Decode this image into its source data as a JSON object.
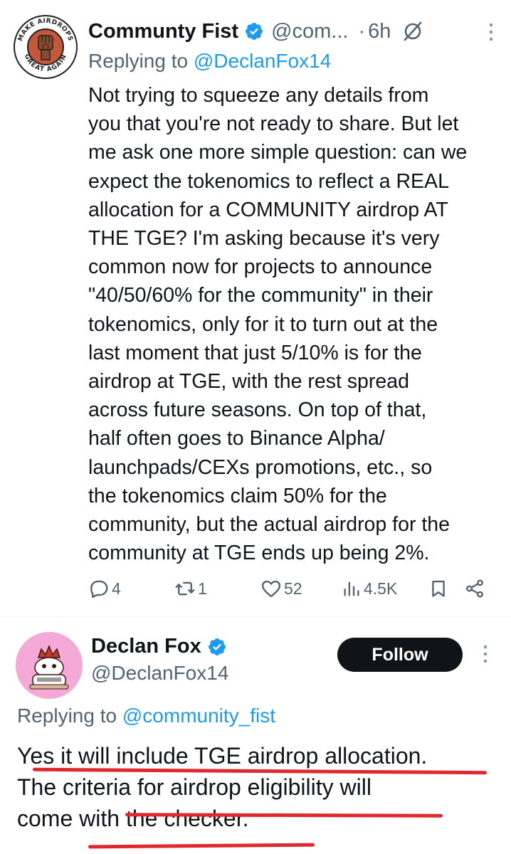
{
  "first_tweet": {
    "author_name": "Community Fist",
    "author_display": "Communty Fist",
    "handle": "@com...",
    "dot": "·",
    "time": "6h",
    "avatar_text_top": "MAKE AIRDROPS",
    "avatar_text_bottom": "GREAT AGAIN",
    "replying_prefix": "Replying to ",
    "replying_to": "@DeclanFox14",
    "text_lines": [
      "Not trying to squeeze any details from",
      "you that you're not ready to share. But let",
      "me ask one more simple question: can we",
      "expect the tokenomics to reflect a REAL",
      "allocation for a COMMUNITY airdrop AT",
      "THE TGE? I'm asking because it's very",
      "common now for projects to announce",
      "\"40/50/60% for the community\" in their",
      "tokenomics, only for it to turn out at the",
      "last moment that just 5/10% is for the",
      "airdrop at TGE, with the rest spread",
      "across future seasons. On top of that,",
      "half often goes to Binance Alpha/",
      "launchpads/CEXs promotions, etc., so",
      "the tokenomics claim 50% for the",
      "community, but the actual airdrop for the",
      "community at TGE ends up being 2%."
    ],
    "stats": {
      "replies": "4",
      "reposts": "1",
      "likes": "52",
      "views": "4.5K"
    }
  },
  "second_tweet": {
    "author_name": "Declan Fox",
    "handle": "@DeclanFox14",
    "follow_label": "Follow",
    "replying_prefix": "Replying to ",
    "replying_to": "@community_fist",
    "text_lines": [
      "Yes it will include TGE airdrop allocation.",
      "The criteria for airdrop eligibility will",
      "come with the checker."
    ]
  },
  "colors": {
    "text": "#0f1419",
    "secondary": "#536471",
    "link": "#1d9bf0",
    "verified": "#1d9bf0",
    "underline": "#e0282e",
    "avatar2_bg": "#f5a9d6"
  }
}
